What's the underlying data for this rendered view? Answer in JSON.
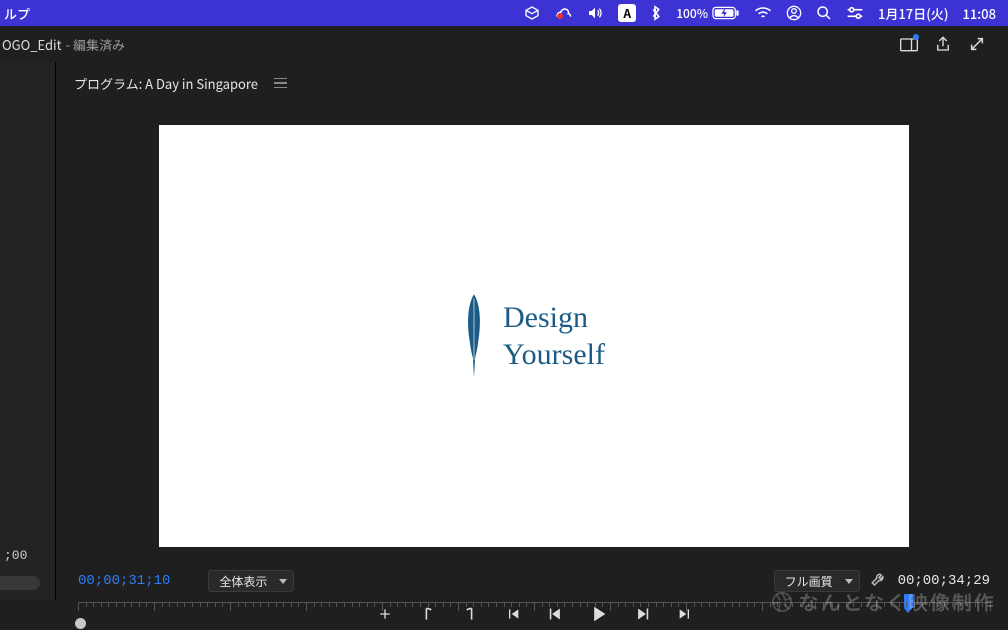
{
  "menubar": {
    "menu_item": "ルプ",
    "battery_pct": "100%",
    "date": "1月17日(火)",
    "time": "11:08",
    "lang_indicator": "A"
  },
  "titlebar": {
    "document": "OGO_Edit",
    "status": "- 編集済み"
  },
  "panel": {
    "tab_label": "プログラム: A Day in Singapore"
  },
  "preview_logo": {
    "line1": "Design",
    "line2": "Yourself"
  },
  "controls": {
    "zoom_label": "全体表示",
    "quality_label": "フル画質",
    "timecode_current": "00;00;31;10",
    "timecode_total": "00;00;34;29",
    "left_panel_time": ";00"
  },
  "watermark": {
    "text": "なんとなく映像制作"
  }
}
